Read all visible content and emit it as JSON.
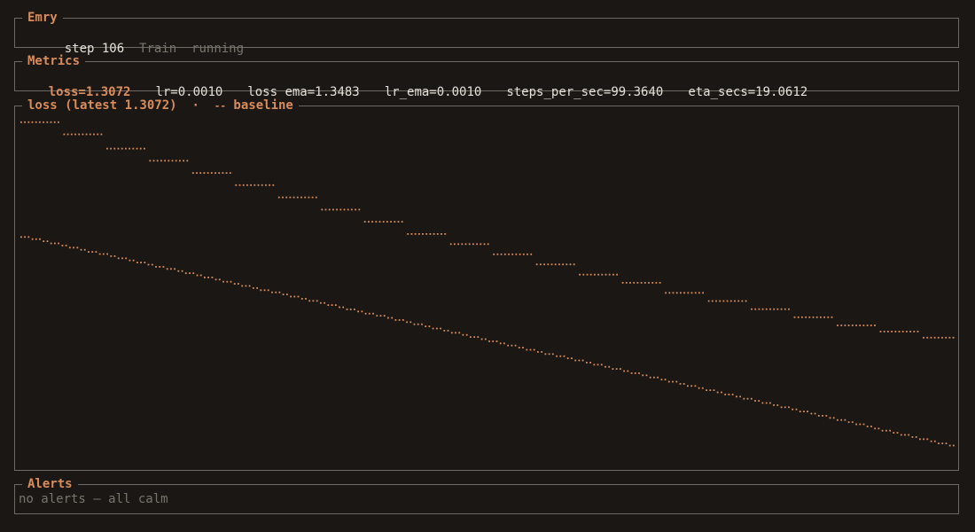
{
  "header": {
    "title": "Emry",
    "step": "step 106",
    "mode": "Train",
    "status": "running"
  },
  "metrics": {
    "title": "Metrics",
    "items": [
      "loss=1.3072",
      "lr=0.0010",
      "loss_ema=1.3483",
      "lr_ema=0.0010",
      "steps_per_sec=99.3640",
      "eta_secs=19.0612"
    ]
  },
  "chart": {
    "title": "loss (latest 1.3072)",
    "separator": "·",
    "baseline_marker": "--",
    "baseline_label": "baseline"
  },
  "alerts": {
    "title": "Alerts",
    "message": "no alerts — all calm"
  },
  "colors": {
    "background": "#1a1714",
    "accent": "#d98c5c",
    "border": "#6e6963",
    "muted": "#7a746c",
    "text": "#e6e0d8"
  },
  "chart_data": {
    "type": "line",
    "title": "loss (latest 1.3072)",
    "xlabel": "",
    "ylabel": "",
    "x": [
      0,
      106
    ],
    "series": [
      {
        "name": "baseline",
        "style": "dotted-step",
        "steps": [
          [
            0,
            9,
            2.9
          ],
          [
            10,
            19,
            2.84
          ],
          [
            20,
            29,
            2.77
          ],
          [
            30,
            39,
            2.71
          ],
          [
            40,
            49,
            2.65
          ],
          [
            50,
            59,
            2.59
          ],
          [
            60,
            69,
            2.53
          ],
          [
            70,
            79,
            2.47
          ],
          [
            80,
            89,
            2.41
          ],
          [
            90,
            99,
            2.35
          ],
          [
            100,
            109,
            2.3
          ],
          [
            110,
            119,
            2.25
          ],
          [
            120,
            129,
            2.2
          ],
          [
            130,
            139,
            2.15
          ],
          [
            140,
            149,
            2.11
          ],
          [
            150,
            159,
            2.06
          ],
          [
            160,
            169,
            2.02
          ],
          [
            170,
            179,
            1.98
          ],
          [
            180,
            189,
            1.94
          ],
          [
            190,
            199,
            1.9
          ],
          [
            200,
            209,
            1.87
          ],
          [
            210,
            217,
            1.84
          ]
        ]
      },
      {
        "name": "loss",
        "style": "dotted",
        "start": 2.34,
        "end": 1.3072
      }
    ],
    "legend": "top-left",
    "grid": false
  }
}
